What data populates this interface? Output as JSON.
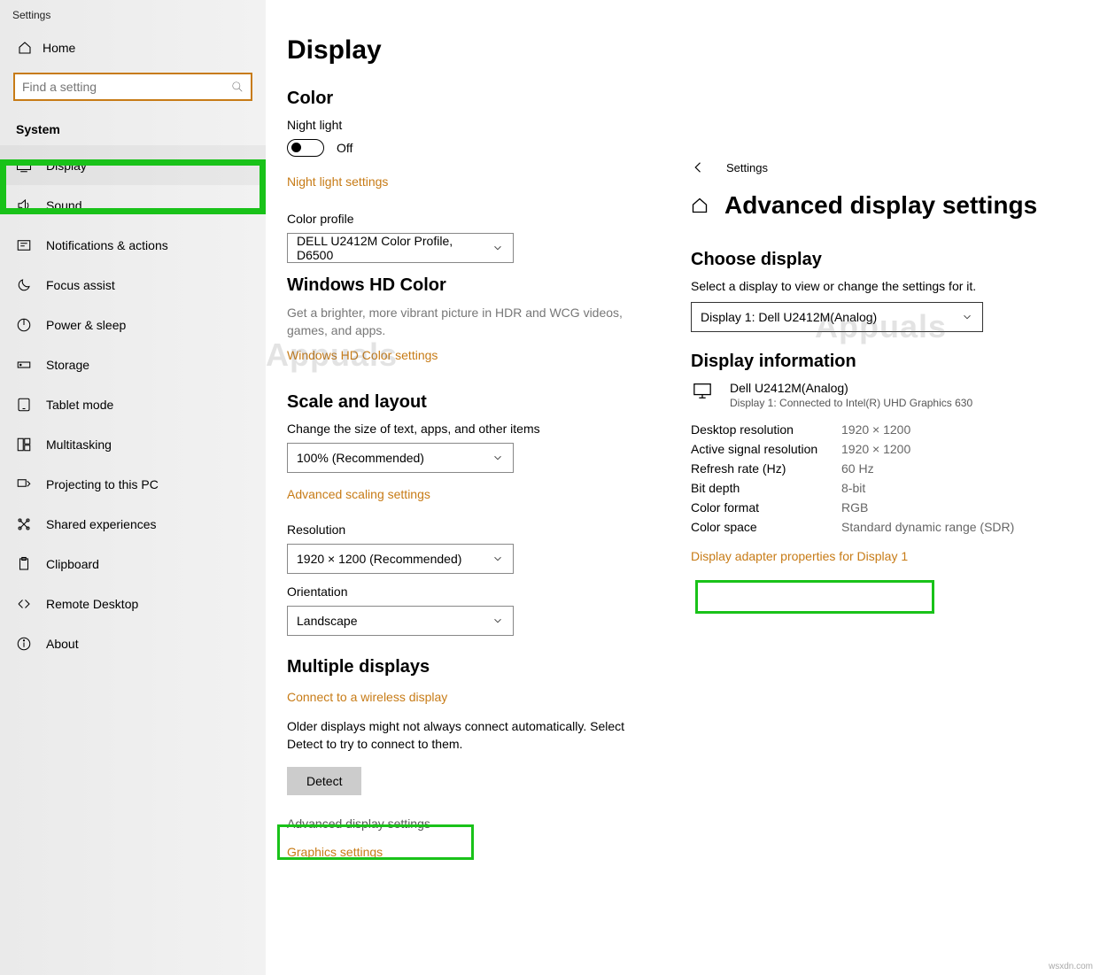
{
  "window_title": "Settings",
  "sidebar": {
    "home": "Home",
    "search_placeholder": "Find a setting",
    "category": "System",
    "items": [
      "Display",
      "Sound",
      "Notifications & actions",
      "Focus assist",
      "Power & sleep",
      "Storage",
      "Tablet mode",
      "Multitasking",
      "Projecting to this PC",
      "Shared experiences",
      "Clipboard",
      "Remote Desktop",
      "About"
    ]
  },
  "main": {
    "title": "Display",
    "color_h": "Color",
    "night_label": "Night light",
    "night_state": "Off",
    "night_link": "Night light settings",
    "profile_label": "Color profile",
    "profile_value": "DELL U2412M Color Profile, D6500",
    "hd_h": "Windows HD Color",
    "hd_desc": "Get a brighter, more vibrant picture in HDR and WCG videos, games, and apps.",
    "hd_link": "Windows HD Color settings",
    "scale_h": "Scale and layout",
    "scale_label": "Change the size of text, apps, and other items",
    "scale_value": "100% (Recommended)",
    "scale_link": "Advanced scaling settings",
    "res_label": "Resolution",
    "res_value": "1920 × 1200 (Recommended)",
    "orient_label": "Orientation",
    "orient_value": "Landscape",
    "multi_h": "Multiple displays",
    "wireless_link": "Connect to a wireless display",
    "detect_desc": "Older displays might not always connect automatically. Select Detect to try to connect to them.",
    "detect_btn": "Detect",
    "adv_disp_link": "Advanced display settings",
    "gfx_link": "Graphics settings"
  },
  "right": {
    "back": "Settings",
    "title": "Advanced display settings",
    "choose_h": "Choose display",
    "choose_desc": "Select a display to view or change the settings for it.",
    "choose_value": "Display 1: Dell U2412M(Analog)",
    "info_h": "Display information",
    "disp_name": "Dell U2412M(Analog)",
    "disp_conn": "Display 1: Connected to Intel(R) UHD Graphics 630",
    "rows": [
      {
        "k": "Desktop resolution",
        "v": "1920 × 1200"
      },
      {
        "k": "Active signal resolution",
        "v": "1920 × 1200"
      },
      {
        "k": "Refresh rate (Hz)",
        "v": "60 Hz"
      },
      {
        "k": "Bit depth",
        "v": "8-bit"
      },
      {
        "k": "Color format",
        "v": "RGB"
      },
      {
        "k": "Color space",
        "v": "Standard dynamic range (SDR)"
      }
    ],
    "adapter_link": "Display adapter properties for Display 1"
  },
  "watermark": "wsxdn.com",
  "brand": "Appuals"
}
